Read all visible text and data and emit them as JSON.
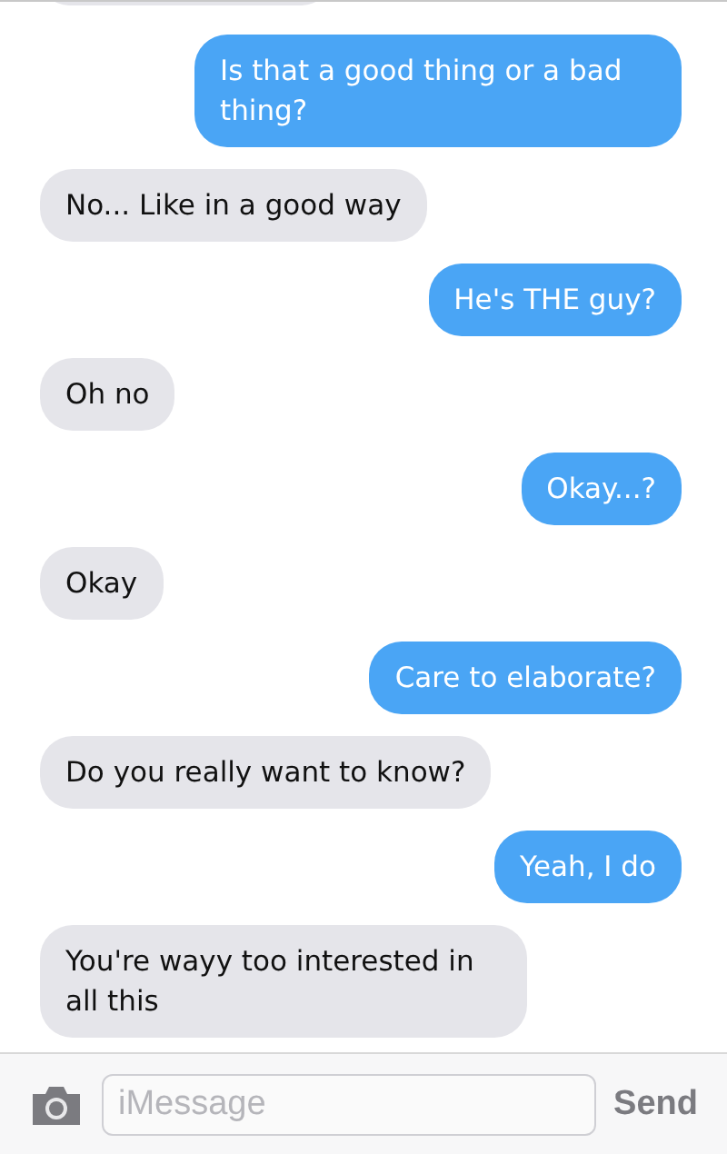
{
  "messages": [
    {
      "kind": "sent",
      "text": "Is that a good thing or a bad thing?"
    },
    {
      "kind": "received",
      "text": "No... Like in a good way"
    },
    {
      "kind": "sent",
      "text": "He's THE guy?"
    },
    {
      "kind": "received",
      "text": "Oh no"
    },
    {
      "kind": "sent",
      "text": "Okay...?"
    },
    {
      "kind": "received",
      "text": "Okay"
    },
    {
      "kind": "sent",
      "text": "Care to elaborate?"
    },
    {
      "kind": "received",
      "text": "Do you really want to know?"
    },
    {
      "kind": "sent",
      "text": "Yeah, I do"
    },
    {
      "kind": "received",
      "text": "You're wayy too interested in all this"
    }
  ],
  "composer": {
    "placeholder": "iMessage",
    "send": "Send"
  }
}
